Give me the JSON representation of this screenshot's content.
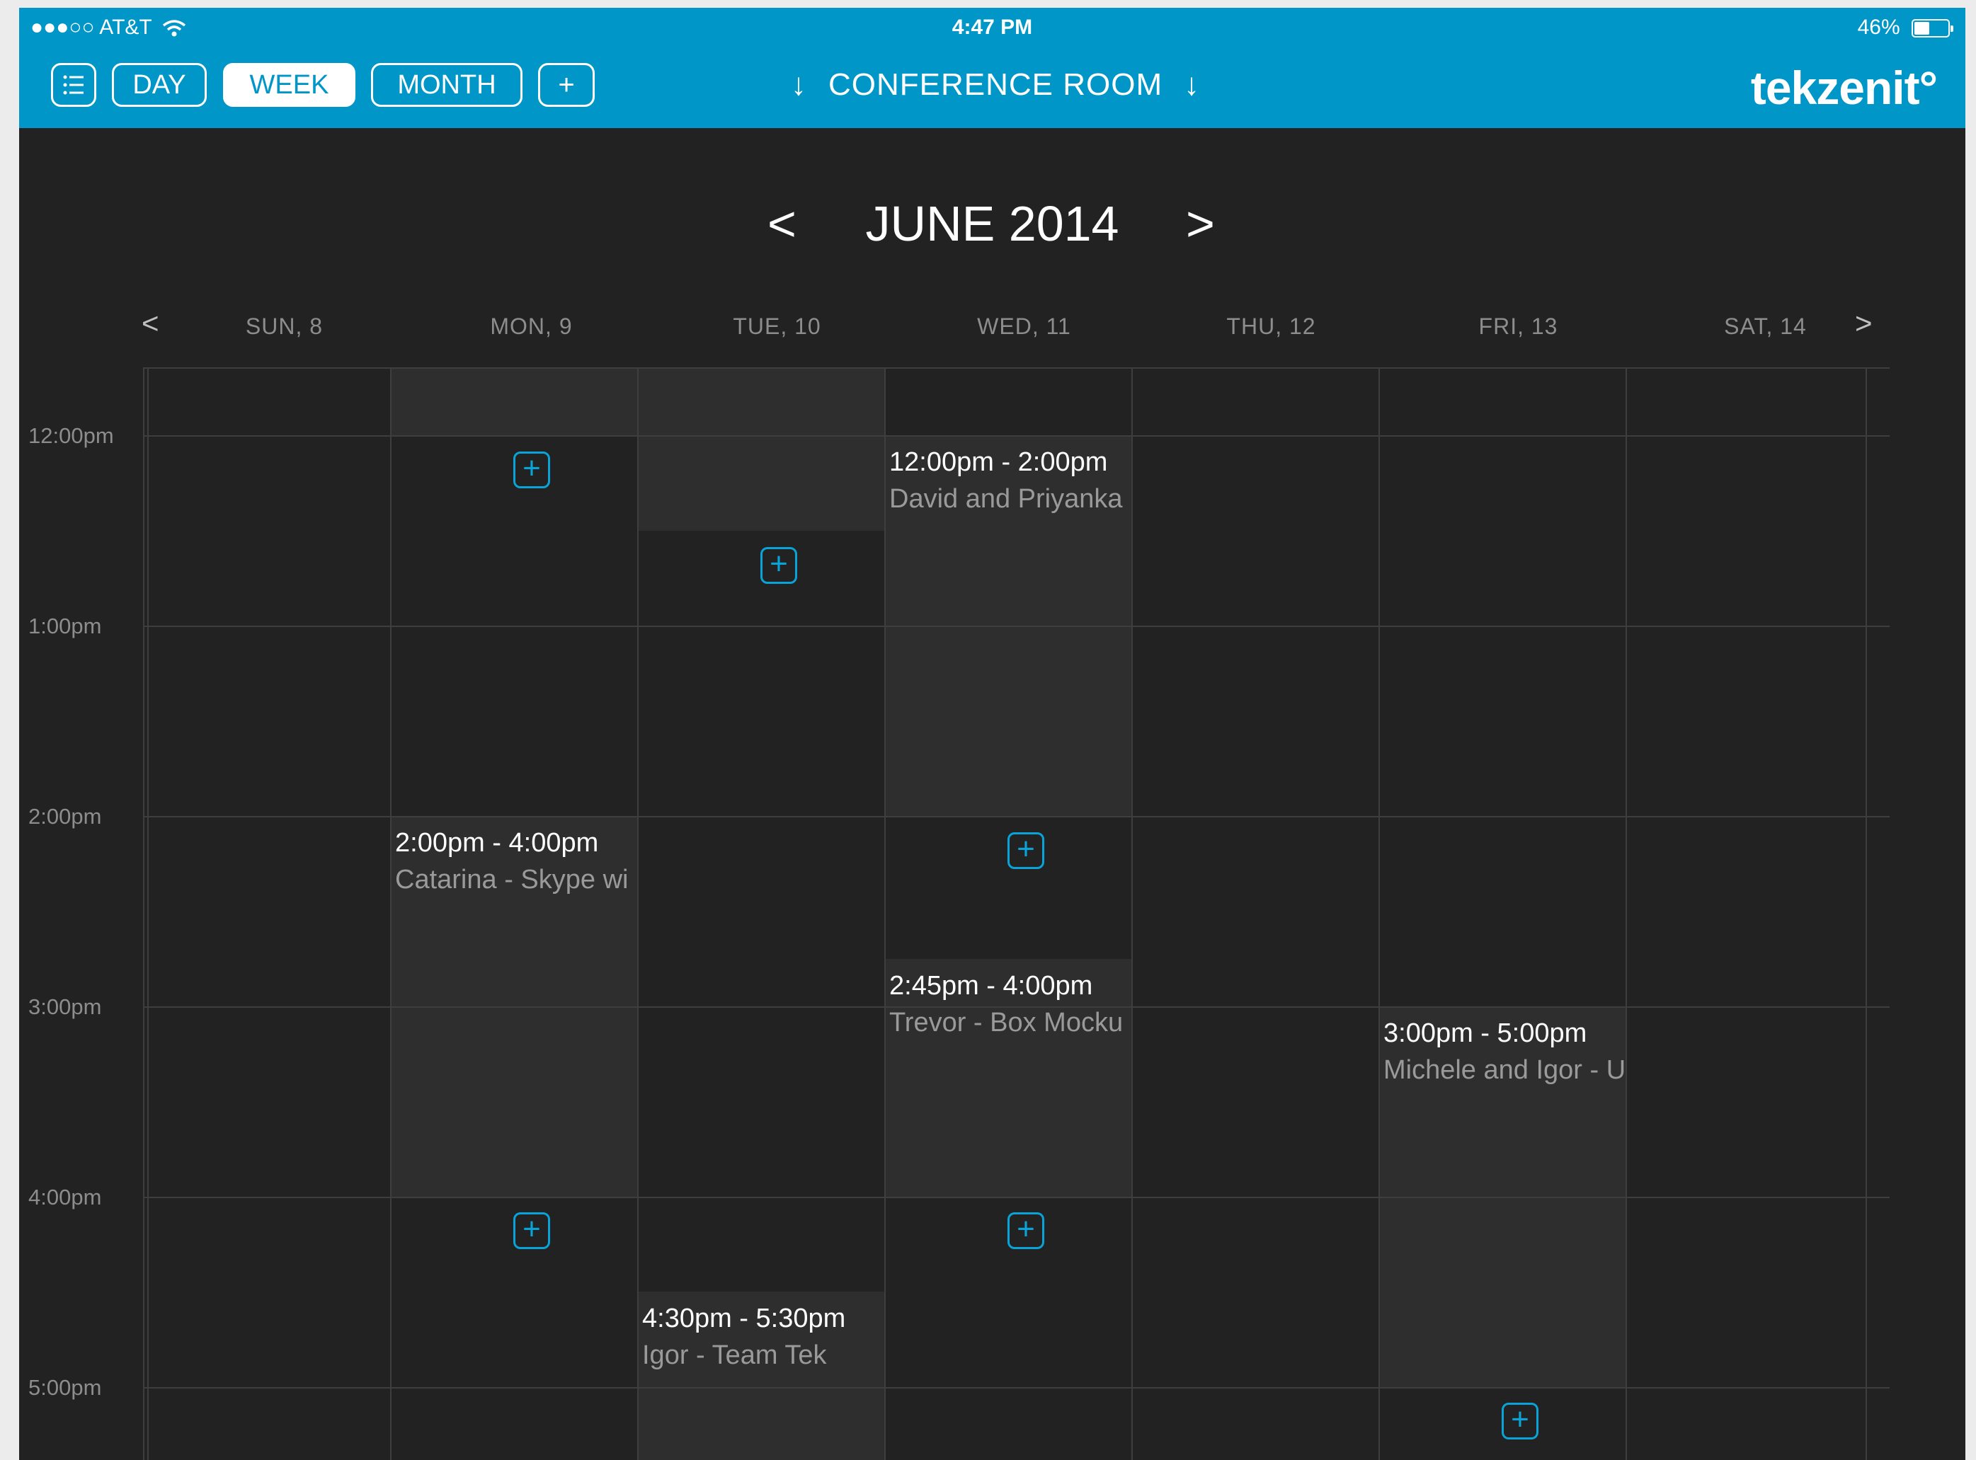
{
  "status_bar": {
    "carrier": "●●●○○ AT&T",
    "time": "4:47 PM",
    "battery": "46%"
  },
  "toolbar": {
    "menu_icon": "list-icon",
    "day_label": "DAY",
    "week_label": "WEEK",
    "month_label": "MONTH",
    "add_label": "+",
    "room_label": "CONFERENCE ROOM",
    "room_arrow": "↓",
    "logo": "tekzenit°",
    "active_view": "WEEK",
    "accent_color": "#0096c8"
  },
  "calendar": {
    "month_title": "JUNE 2014",
    "prev_month": "<",
    "next_month": ">",
    "prev_week": "<",
    "next_week": ">",
    "days": [
      "SUN, 8",
      "MON, 9",
      "TUE, 10",
      "WED, 11",
      "THU, 12",
      "FRI, 13",
      "SAT, 14"
    ],
    "time_labels": [
      "12:00pm",
      "1:00pm",
      "2:00pm",
      "3:00pm",
      "4:00pm",
      "5:00pm"
    ],
    "add_symbol": "+",
    "events": [
      {
        "day": "WED, 11",
        "time": "12:00pm - 2:00pm",
        "title": "David and Priyanka"
      },
      {
        "day": "MON, 9",
        "time": "2:00pm - 4:00pm",
        "title": "Catarina - Skype wi"
      },
      {
        "day": "WED, 11",
        "time": "2:45pm - 4:00pm",
        "title": "Trevor - Box Mocku"
      },
      {
        "day": "FRI, 13",
        "time": "3:00pm - 5:00pm",
        "title": "Michele and Igor - U"
      },
      {
        "day": "TUE, 10",
        "time": "4:30pm - 5:30pm",
        "title": "Igor - Team Tek"
      }
    ]
  }
}
